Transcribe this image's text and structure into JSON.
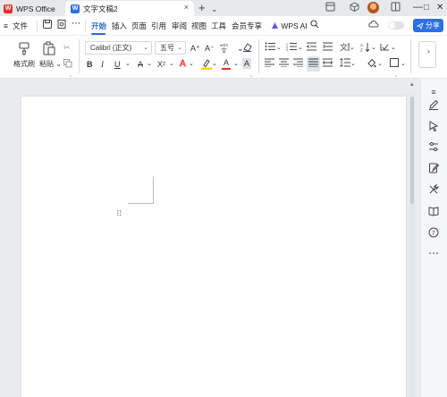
{
  "titlebar": {
    "app_tab": "WPS Office",
    "app_logo": "W",
    "doc_tab": "文字文稿2",
    "doc_logo": "W",
    "close_tab": "×",
    "new_tab": "+",
    "tab_menu": "⌄",
    "minimize": "—",
    "maximize": "□",
    "close": "✕"
  },
  "menubar": {
    "file_label": "文件",
    "tabs": [
      "开始",
      "插入",
      "页面",
      "引用",
      "审阅",
      "视图",
      "工具",
      "会员专享"
    ],
    "ai_label": "WPS AI",
    "share_label": "分享"
  },
  "ribbon": {
    "format_painter": "格式刷",
    "paste": "粘贴",
    "font_name": "Calibri (正文)",
    "font_size": "五号",
    "bold": "B",
    "italic": "I",
    "underline": "U",
    "strike": "A",
    "superscript": "X²",
    "grow_font": "A⁺",
    "shrink_font": "A⁻",
    "highlight": "A",
    "font_color": "A",
    "char_border": "A"
  },
  "colors": {
    "accent": "#2a6ad6",
    "share": "#2b70e6",
    "wps_red": "#e0332a",
    "highlight_yellow": "#f5d800",
    "font_red": "#e23030"
  }
}
